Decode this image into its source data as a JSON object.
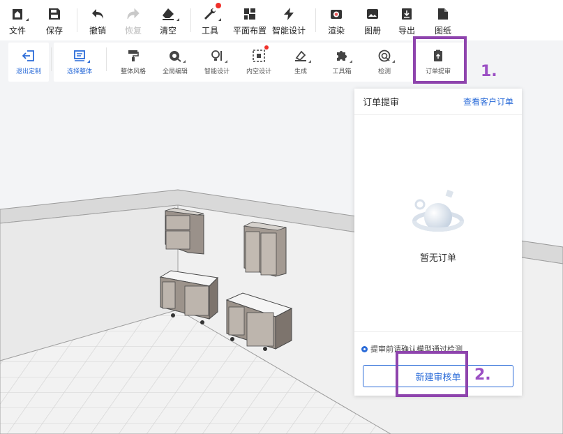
{
  "toolbar": {
    "items": [
      {
        "label": "文件",
        "icon": "home-file-icon"
      },
      {
        "label": "保存",
        "icon": "save-icon"
      },
      {
        "label": "撤销",
        "icon": "undo-icon"
      },
      {
        "label": "恢复",
        "icon": "redo-icon"
      },
      {
        "label": "清空",
        "icon": "eraser-icon"
      },
      {
        "label": "工具",
        "icon": "wrench-icon"
      },
      {
        "label": "平面布置",
        "icon": "floorplan-icon"
      },
      {
        "label": "智能设计",
        "icon": "lightning-icon"
      },
      {
        "label": "渲染",
        "icon": "camera-icon"
      },
      {
        "label": "图册",
        "icon": "album-icon"
      },
      {
        "label": "导出",
        "icon": "export-icon"
      },
      {
        "label": "图纸",
        "icon": "drawing-icon"
      }
    ]
  },
  "subtoolbar": {
    "items": [
      {
        "label": "退出定制",
        "icon": "exit-icon"
      },
      {
        "label": "选择整体",
        "icon": "select-all-icon"
      },
      {
        "label": "整体风格",
        "icon": "paint-roller-icon"
      },
      {
        "label": "全局编辑",
        "icon": "global-edit-icon"
      },
      {
        "label": "智能设计",
        "icon": "bulb-icon"
      },
      {
        "label": "内空设计",
        "icon": "inner-space-icon"
      },
      {
        "label": "生成",
        "icon": "generate-icon"
      },
      {
        "label": "工具箱",
        "icon": "puzzle-icon"
      },
      {
        "label": "检测",
        "icon": "check-icon"
      },
      {
        "label": "订单提审",
        "icon": "order-submit-icon"
      }
    ]
  },
  "annotations": {
    "one": "1.",
    "two": "2."
  },
  "panel": {
    "title": "订单提审",
    "link": "查看客户订单",
    "empty": "暂无订单",
    "notice": "提审前请确认模型通过检测",
    "button": "新建审核单"
  },
  "colors": {
    "accent": "#2a6bd8",
    "annotation": "#8e44ad",
    "badge": "#f0302a"
  }
}
